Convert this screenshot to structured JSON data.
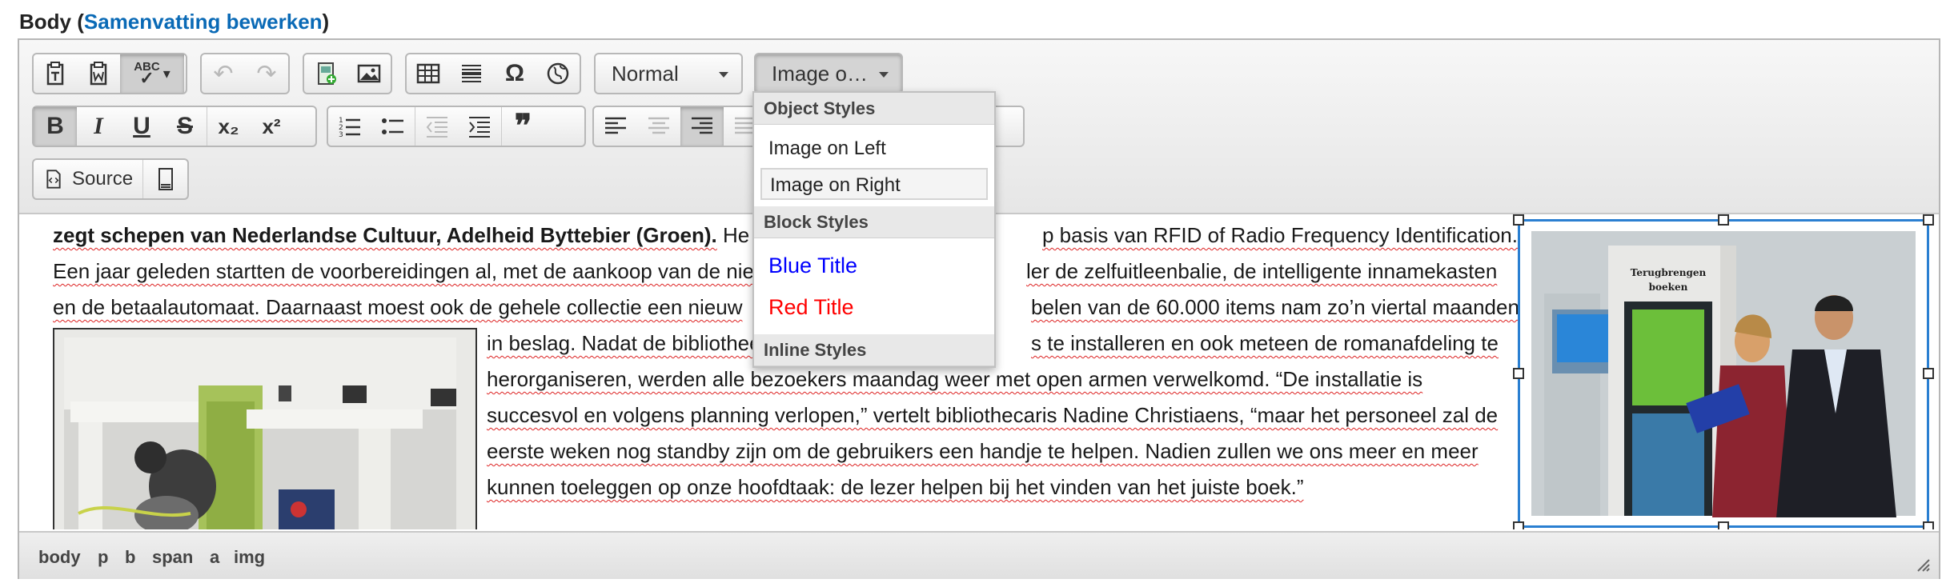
{
  "field": {
    "label": "Body",
    "paren_open": " (",
    "link": "Samenvatting bewerken",
    "paren_close": ")"
  },
  "toolbar": {
    "row1": {
      "clipboard": [
        {
          "name": "paste-text-icon"
        },
        {
          "name": "paste-from-word-icon"
        },
        {
          "name": "spellcheck-icon",
          "caret": "▾"
        }
      ],
      "undo": [
        {
          "name": "undo-icon",
          "glyph": "↶"
        },
        {
          "name": "redo-icon",
          "glyph": "↷"
        }
      ],
      "insert": [
        {
          "name": "insert-media-icon"
        },
        {
          "name": "image-icon"
        }
      ],
      "table": [
        {
          "name": "table-icon"
        },
        {
          "name": "horizontal-line-icon"
        },
        {
          "name": "special-char-icon",
          "glyph": "Ω"
        },
        {
          "name": "iframe-icon"
        }
      ],
      "format_combo": "Normal",
      "styles_combo": "Image o…"
    },
    "row2": {
      "basic": [
        {
          "name": "bold-icon",
          "glyph": "B"
        },
        {
          "name": "italic-icon",
          "glyph": "I"
        },
        {
          "name": "underline-icon",
          "glyph": "U"
        },
        {
          "name": "strikethrough-icon",
          "glyph": "S"
        },
        {
          "name": "subscript-icon",
          "glyph": "x₂"
        },
        {
          "name": "superscript-icon",
          "glyph": "x²"
        }
      ],
      "list": [
        {
          "name": "numbered-list-icon"
        },
        {
          "name": "bulleted-list-icon"
        },
        {
          "name": "outdent-icon"
        },
        {
          "name": "indent-icon"
        },
        {
          "name": "blockquote-icon",
          "glyph": "❞"
        }
      ],
      "align": [
        {
          "name": "align-left-icon"
        },
        {
          "name": "align-center-icon"
        },
        {
          "name": "align-right-icon"
        },
        {
          "name": "justify-icon"
        }
      ]
    },
    "row3": {
      "source": "Source"
    }
  },
  "dropdown": {
    "object_styles": "Object Styles",
    "image_left": "Image on Left",
    "image_right": "Image on Right",
    "block_styles": "Block Styles",
    "blue_title": "Blue Title",
    "red_title": "Red Title",
    "inline_styles": "Inline Styles",
    "colors": {
      "blue": "#0000ff",
      "red": "#ff0000"
    }
  },
  "content": {
    "l1_bold": "zegt schepen van Nederlandse Cultuur, Adelheid Byttebier (Groen).",
    "l1_a": "He",
    "l1_b": "p basis van RFID of Radio Frequency Identification.",
    "l2_a": "Een jaar geleden startten de voorbereidingen al, met de aankoop van de nie",
    "l2_b": "ler de zelfuitleenbalie, de intelligente innamekasten",
    "l3_a": "en de betaalautomaat. Daarnaast moest ook de gehele collectie een nieuw",
    "l3_b": "belen van de 60.000 items nam zo’n viertal maanden",
    "l4_a": "in beslag. Nadat de bibliotheek",
    "l4_b": "s te installeren en ook meteen de romanafdeling te",
    "l5": "herorganiseren, werden alle bezoekers maandag weer met open armen verwelkomd. “De installatie is",
    "l6": "succesvol en volgens planning verlopen,” vertelt bibliothecaris Nadine Christiaens, “maar het personeel zal de",
    "l7": "eerste weken nog standby zijn om de gebruikers een handje te helpen. Nadien zullen we ons meer en meer",
    "l8": "kunnen toeleggen op onze hoofdtaak: de lezer helpen bij het vinden van het juiste boek.”",
    "photo_sign": "Terugbrengen\nboeken"
  },
  "status": {
    "path": [
      "body",
      "p",
      "b",
      "span",
      "a",
      "img"
    ]
  }
}
